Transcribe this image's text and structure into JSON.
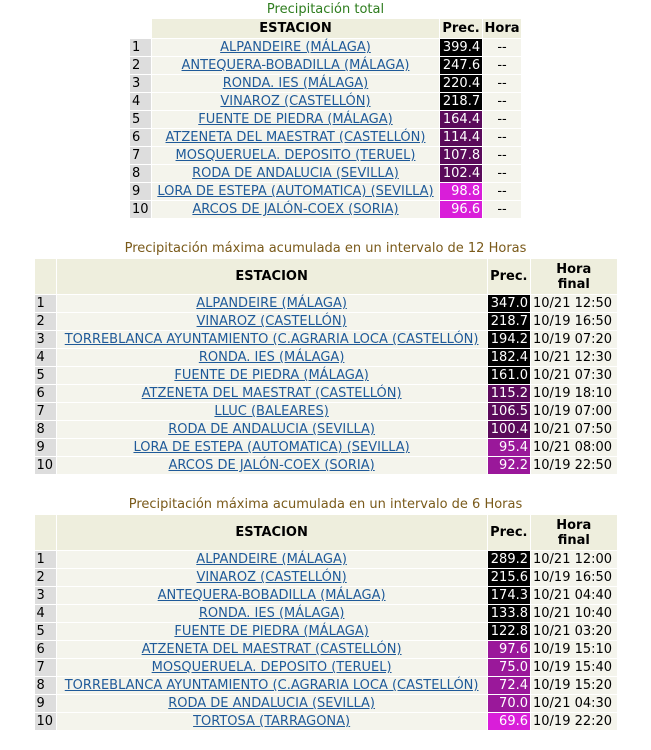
{
  "colors": {
    "black": "#000000",
    "dark_purple": "#5a0a5a",
    "purple": "#9a189a",
    "magenta": "#d91ed9"
  },
  "table1": {
    "caption": "Precipitación total",
    "headers": {
      "station": "ESTACION",
      "prec": "Prec.",
      "hora": "Hora"
    },
    "rows": [
      {
        "n": "1",
        "station": "ALPANDEIRE (MÁLAGA)",
        "prec": "399.4",
        "hora": "--",
        "color": "#000000"
      },
      {
        "n": "2",
        "station": "ANTEQUERA-BOBADILLA (MÁLAGA)",
        "prec": "247.6",
        "hora": "--",
        "color": "#000000"
      },
      {
        "n": "3",
        "station": "RONDA. IES (MÁLAGA)",
        "prec": "220.4",
        "hora": "--",
        "color": "#000000"
      },
      {
        "n": "4",
        "station": "VINAROZ (CASTELLÓN)",
        "prec": "218.7",
        "hora": "--",
        "color": "#000000"
      },
      {
        "n": "5",
        "station": "FUENTE DE PIEDRA (MÁLAGA)",
        "prec": "164.4",
        "hora": "--",
        "color": "#5a0a5a"
      },
      {
        "n": "6",
        "station": "ATZENETA DEL MAESTRAT (CASTELLÓN)",
        "prec": "114.4",
        "hora": "--",
        "color": "#5a0a5a"
      },
      {
        "n": "7",
        "station": "MOSQUERUELA. DEPOSITO (TERUEL)",
        "prec": "107.8",
        "hora": "--",
        "color": "#5a0a5a"
      },
      {
        "n": "8",
        "station": "RODA DE ANDALUCIA (SEVILLA)",
        "prec": "102.4",
        "hora": "--",
        "color": "#5a0a5a"
      },
      {
        "n": "9",
        "station": "LORA DE ESTEPA (AUTOMATICA) (SEVILLA)",
        "prec": "98.8",
        "hora": "--",
        "color": "#d91ed9"
      },
      {
        "n": "10",
        "station": "ARCOS DE JALÓN-COEX (SORIA)",
        "prec": "96.6",
        "hora": "--",
        "color": "#d91ed9"
      }
    ]
  },
  "table2": {
    "caption": "Precipitación máxima acumulada en un intervalo de 12 Horas",
    "headers": {
      "station": "ESTACION",
      "prec": "Prec.",
      "hora_line1": "Hora",
      "hora_line2": "final"
    },
    "rows": [
      {
        "n": "1",
        "station": "ALPANDEIRE (MÁLAGA)",
        "prec": "347.0",
        "hora": "10/21 12:50",
        "color": "#000000"
      },
      {
        "n": "2",
        "station": "VINAROZ (CASTELLÓN)",
        "prec": "218.7",
        "hora": "10/19 16:50",
        "color": "#000000"
      },
      {
        "n": "3",
        "station": "TORREBLANCA AYUNTAMIENTO (C.AGRARIA LOCA (CASTELLÓN)",
        "prec": "194.2",
        "hora": "10/19 07:20",
        "color": "#000000"
      },
      {
        "n": "4",
        "station": "RONDA. IES (MÁLAGA)",
        "prec": "182.4",
        "hora": "10/21 12:30",
        "color": "#000000"
      },
      {
        "n": "5",
        "station": "FUENTE DE PIEDRA (MÁLAGA)",
        "prec": "161.0",
        "hora": "10/21 07:30",
        "color": "#000000"
      },
      {
        "n": "6",
        "station": "ATZENETA DEL MAESTRAT (CASTELLÓN)",
        "prec": "115.2",
        "hora": "10/19 18:10",
        "color": "#5a0a5a"
      },
      {
        "n": "7",
        "station": "LLUC (BALEARES)",
        "prec": "106.5",
        "hora": "10/19 07:00",
        "color": "#5a0a5a"
      },
      {
        "n": "8",
        "station": "RODA DE ANDALUCIA (SEVILLA)",
        "prec": "100.4",
        "hora": "10/21 07:50",
        "color": "#5a0a5a"
      },
      {
        "n": "9",
        "station": "LORA DE ESTEPA (AUTOMATICA) (SEVILLA)",
        "prec": "95.4",
        "hora": "10/21 08:00",
        "color": "#9a189a"
      },
      {
        "n": "10",
        "station": "ARCOS DE JALÓN-COEX (SORIA)",
        "prec": "92.2",
        "hora": "10/19 22:50",
        "color": "#9a189a"
      }
    ]
  },
  "table3": {
    "caption": "Precipitación máxima acumulada en un intervalo de 6 Horas",
    "headers": {
      "station": "ESTACION",
      "prec": "Prec.",
      "hora_line1": "Hora",
      "hora_line2": "final"
    },
    "rows": [
      {
        "n": "1",
        "station": "ALPANDEIRE (MÁLAGA)",
        "prec": "289.2",
        "hora": "10/21 12:00",
        "color": "#000000"
      },
      {
        "n": "2",
        "station": "VINAROZ (CASTELLÓN)",
        "prec": "215.6",
        "hora": "10/19 16:50",
        "color": "#000000"
      },
      {
        "n": "3",
        "station": "ANTEQUERA-BOBADILLA (MÁLAGA)",
        "prec": "174.3",
        "hora": "10/21 04:40",
        "color": "#000000"
      },
      {
        "n": "4",
        "station": "RONDA. IES (MÁLAGA)",
        "prec": "133.8",
        "hora": "10/21 10:40",
        "color": "#000000"
      },
      {
        "n": "5",
        "station": "FUENTE DE PIEDRA (MÁLAGA)",
        "prec": "122.8",
        "hora": "10/21 03:20",
        "color": "#000000"
      },
      {
        "n": "6",
        "station": "ATZENETA DEL MAESTRAT (CASTELLÓN)",
        "prec": "97.6",
        "hora": "10/19 15:10",
        "color": "#9a189a"
      },
      {
        "n": "7",
        "station": "MOSQUERUELA. DEPOSITO (TERUEL)",
        "prec": "75.0",
        "hora": "10/19 15:40",
        "color": "#9a189a"
      },
      {
        "n": "8",
        "station": "TORREBLANCA AYUNTAMIENTO (C.AGRARIA LOCA (CASTELLÓN)",
        "prec": "72.4",
        "hora": "10/19 15:20",
        "color": "#9a189a"
      },
      {
        "n": "9",
        "station": "RODA DE ANDALUCIA (SEVILLA)",
        "prec": "70.0",
        "hora": "10/21 04:30",
        "color": "#9a189a"
      },
      {
        "n": "10",
        "station": "TORTOSA (TARRAGONA)",
        "prec": "69.6",
        "hora": "10/19 22:20",
        "color": "#d91ed9"
      }
    ]
  }
}
